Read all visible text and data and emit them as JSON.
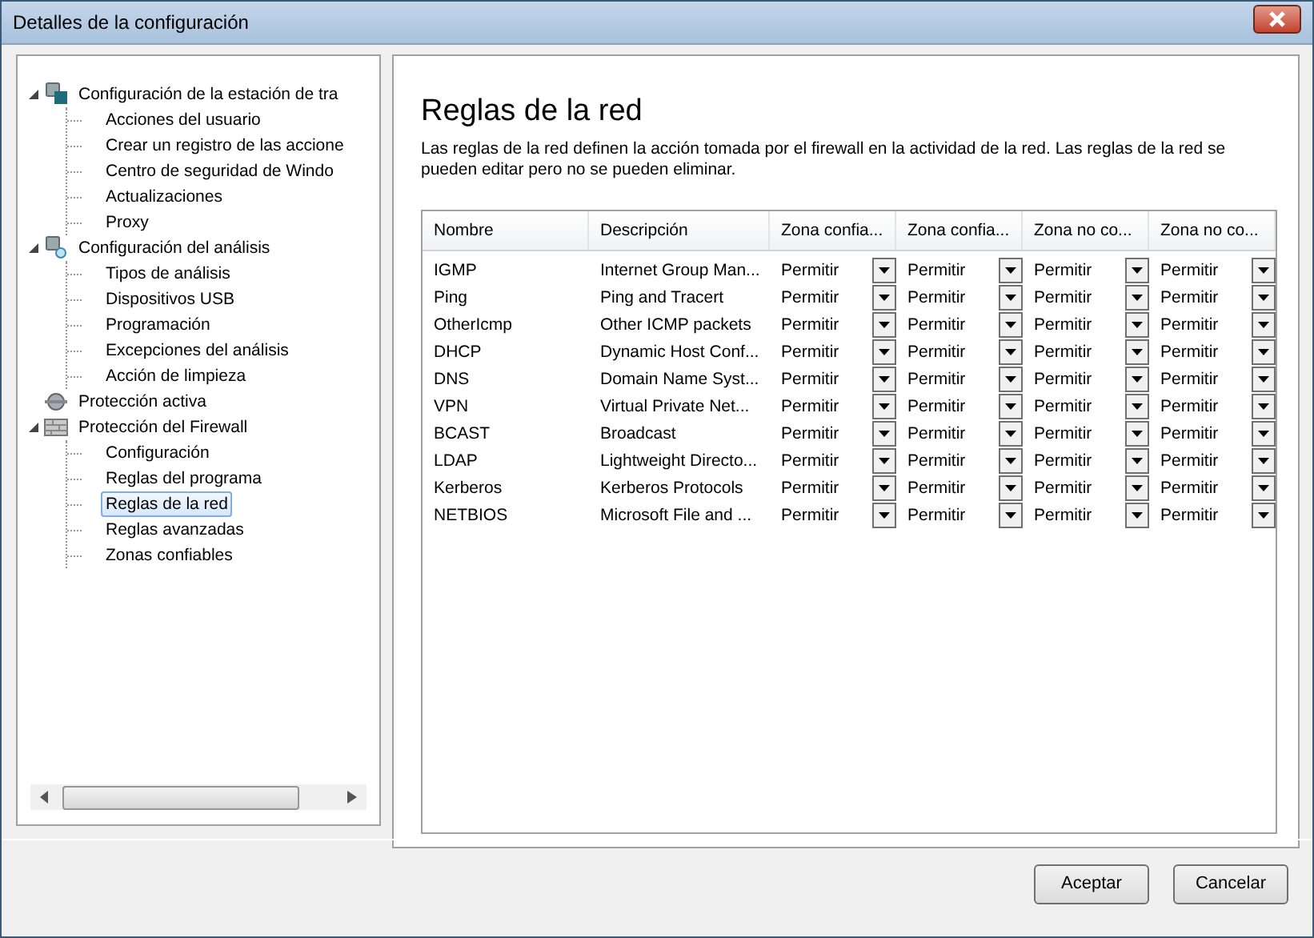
{
  "window": {
    "title": "Detalles de la configuración"
  },
  "tree": [
    {
      "label": "Configuración de la estación de tra",
      "kind": "workstation",
      "expanded": true,
      "selected": false,
      "children": [
        {
          "label": "Acciones del usuario",
          "selected": false
        },
        {
          "label": "Crear un registro de las accione",
          "selected": false
        },
        {
          "label": "Centro de seguridad de Windo",
          "selected": false
        },
        {
          "label": "Actualizaciones",
          "selected": false
        },
        {
          "label": "Proxy",
          "selected": false
        }
      ]
    },
    {
      "label": "Configuración del análisis",
      "kind": "scan",
      "expanded": true,
      "selected": false,
      "children": [
        {
          "label": "Tipos de análisis",
          "selected": false
        },
        {
          "label": "Dispositivos USB",
          "selected": false
        },
        {
          "label": "Programación",
          "selected": false
        },
        {
          "label": "Excepciones del análisis",
          "selected": false
        },
        {
          "label": "Acción de limpieza",
          "selected": false
        }
      ]
    },
    {
      "label": "Protección activa",
      "kind": "active",
      "selected": false
    },
    {
      "label": "Protección del Firewall",
      "kind": "firewall",
      "expanded": true,
      "selected": false,
      "children": [
        {
          "label": "Configuración",
          "selected": false
        },
        {
          "label": "Reglas del  programa",
          "selected": false
        },
        {
          "label": "Reglas de la red",
          "selected": true
        },
        {
          "label": "Reglas avanzadas",
          "selected": false
        },
        {
          "label": "Zonas confiables",
          "selected": false
        }
      ]
    }
  ],
  "page": {
    "heading": "Reglas de la red",
    "description": "Las reglas de la red definen la acción tomada por el firewall en la actividad de la red. Las reglas de la red se pueden editar pero no se pueden eliminar."
  },
  "table": {
    "columns": [
      "Nombre",
      "Descripción",
      "Zona confia...",
      "Zona confia...",
      "Zona no co...",
      "Zona no co..."
    ],
    "rows": [
      {
        "name": "IGMP",
        "description": "Internet Group Man...",
        "zones": [
          "Permitir",
          "Permitir",
          "Permitir",
          "Permitir"
        ]
      },
      {
        "name": "Ping",
        "description": "Ping and Tracert",
        "zones": [
          "Permitir",
          "Permitir",
          "Permitir",
          "Permitir"
        ]
      },
      {
        "name": "OtherIcmp",
        "description": "Other ICMP packets",
        "zones": [
          "Permitir",
          "Permitir",
          "Permitir",
          "Permitir"
        ]
      },
      {
        "name": "DHCP",
        "description": "Dynamic Host Conf...",
        "zones": [
          "Permitir",
          "Permitir",
          "Permitir",
          "Permitir"
        ]
      },
      {
        "name": "DNS",
        "description": "Domain Name Syst...",
        "zones": [
          "Permitir",
          "Permitir",
          "Permitir",
          "Permitir"
        ]
      },
      {
        "name": "VPN",
        "description": "Virtual Private Net...",
        "zones": [
          "Permitir",
          "Permitir",
          "Permitir",
          "Permitir"
        ]
      },
      {
        "name": "BCAST",
        "description": "Broadcast",
        "zones": [
          "Permitir",
          "Permitir",
          "Permitir",
          "Permitir"
        ]
      },
      {
        "name": "LDAP",
        "description": "Lightweight Directo...",
        "zones": [
          "Permitir",
          "Permitir",
          "Permitir",
          "Permitir"
        ]
      },
      {
        "name": "Kerberos",
        "description": "Kerberos Protocols",
        "zones": [
          "Permitir",
          "Permitir",
          "Permitir",
          "Permitir"
        ]
      },
      {
        "name": "NETBIOS",
        "description": "Microsoft File and ...",
        "zones": [
          "Permitir",
          "Permitir",
          "Permitir",
          "Permitir"
        ]
      }
    ]
  },
  "buttons": [
    "Aceptar",
    "Cancelar"
  ]
}
